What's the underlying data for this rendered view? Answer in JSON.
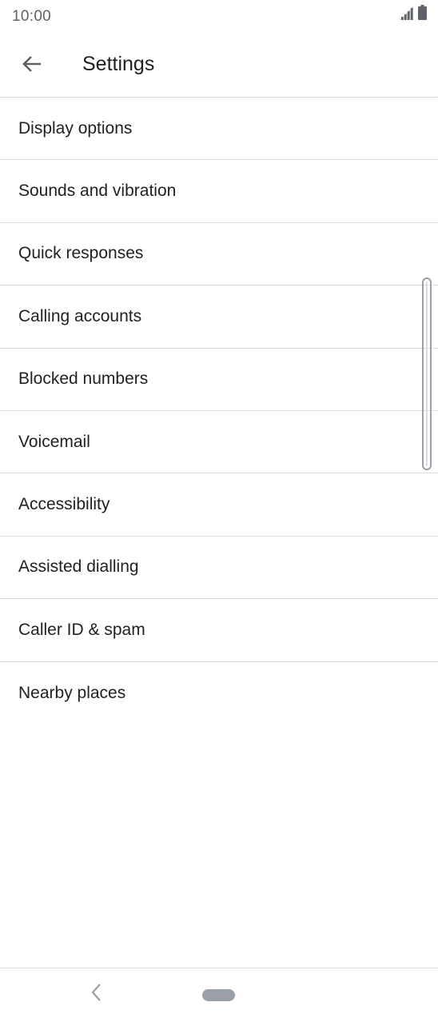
{
  "status_bar": {
    "time": "10:00",
    "icons": [
      "signal-icon",
      "battery-icon"
    ]
  },
  "app_bar": {
    "title": "Settings",
    "back_icon": "arrow-back-icon"
  },
  "settings": {
    "items": [
      {
        "label": "Display options"
      },
      {
        "label": "Sounds and vibration"
      },
      {
        "label": "Quick responses"
      },
      {
        "label": "Calling accounts"
      },
      {
        "label": "Blocked numbers"
      },
      {
        "label": "Voicemail"
      },
      {
        "label": "Accessibility"
      },
      {
        "label": "Assisted dialling"
      },
      {
        "label": "Caller ID & spam"
      },
      {
        "label": "Nearby places"
      }
    ]
  },
  "navigation_bar": {
    "back_icon": "nav-back-icon",
    "home_icon": "nav-home-pill-icon"
  },
  "colors": {
    "text_primary": "#202124",
    "text_secondary": "#5f6368",
    "divider": "#dadce0",
    "background": "#ffffff"
  }
}
